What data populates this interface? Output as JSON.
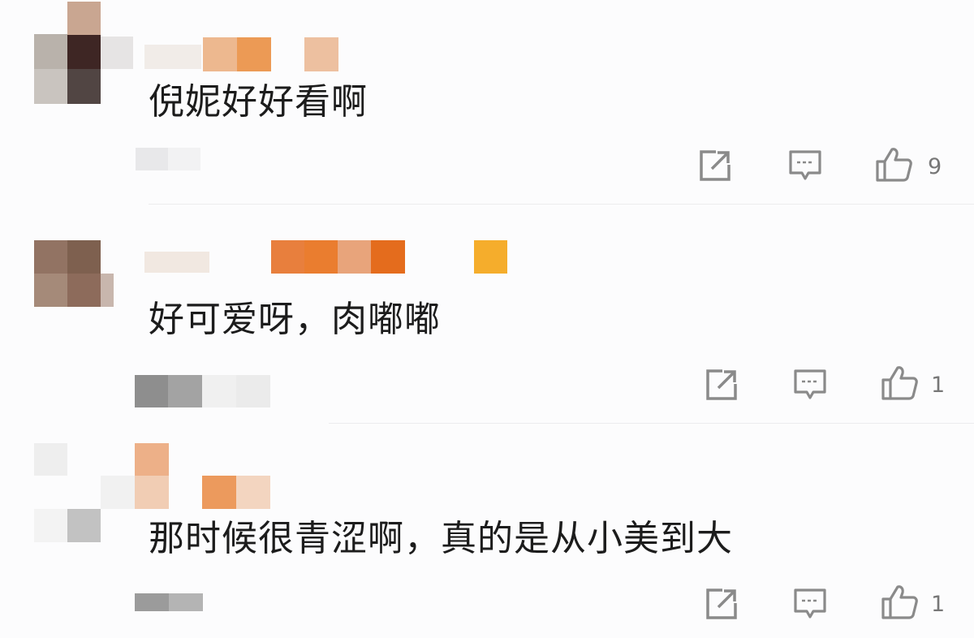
{
  "colors": {
    "background": "#fcfcfd",
    "text": "#1c1c1c",
    "icon": "#8a8a8a",
    "divider": "#ececee"
  },
  "comments": [
    {
      "avatar": "pixelated-avatar",
      "username": "pixelated-username",
      "text": "倪妮好好看啊",
      "timestamp": "pixelated-timestamp",
      "actions": [
        "share-icon",
        "comment-icon",
        "like-icon"
      ],
      "likes": "9"
    },
    {
      "avatar": "pixelated-avatar",
      "username": "pixelated-username",
      "text": "好可爱呀，肉嘟嘟",
      "timestamp": "pixelated-timestamp",
      "actions": [
        "share-icon",
        "comment-icon",
        "like-icon"
      ],
      "likes": "1"
    },
    {
      "avatar": "pixelated-avatar",
      "username": "pixelated-username",
      "text": "那时候很青涩啊，真的是从小美到大",
      "timestamp": "pixelated-timestamp",
      "actions": [
        "share-icon",
        "comment-icon",
        "like-icon"
      ],
      "likes": "1"
    }
  ]
}
